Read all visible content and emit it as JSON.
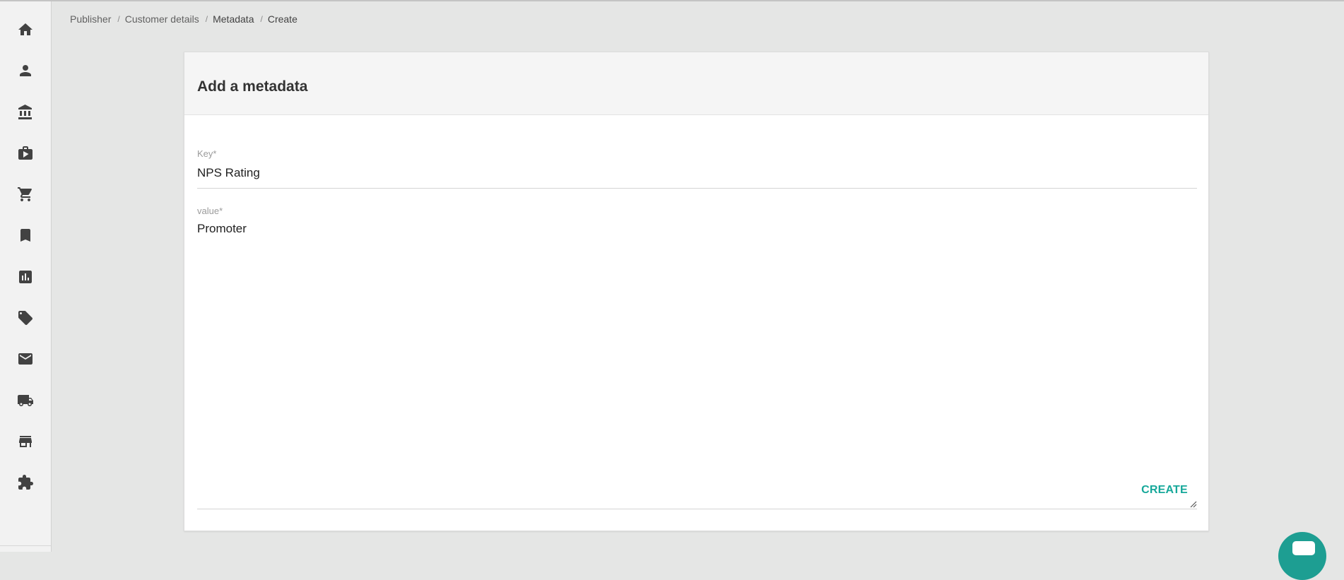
{
  "breadcrumb": {
    "items": [
      "Publisher",
      "Customer details",
      "Metadata",
      "Create"
    ],
    "separator": "/"
  },
  "sidebar": {
    "items": [
      {
        "icon": "home-icon"
      },
      {
        "icon": "person-icon"
      },
      {
        "icon": "bank-icon"
      },
      {
        "icon": "briefcase-play-icon"
      },
      {
        "icon": "cart-icon"
      },
      {
        "icon": "bookmark-icon"
      },
      {
        "icon": "bar-chart-icon"
      },
      {
        "icon": "ticket-icon"
      },
      {
        "icon": "mail-icon"
      },
      {
        "icon": "truck-icon"
      },
      {
        "icon": "store-icon"
      },
      {
        "icon": "puzzle-icon"
      }
    ]
  },
  "form": {
    "title": "Add a metadata",
    "key_label": "Key*",
    "key_value": "NPS Rating",
    "value_label": "value*",
    "value_value": "Promoter",
    "create_label": "CREATE"
  },
  "colors": {
    "accent": "#16a89a",
    "chat": "#1d9e92",
    "background": "#e5e6e5"
  }
}
